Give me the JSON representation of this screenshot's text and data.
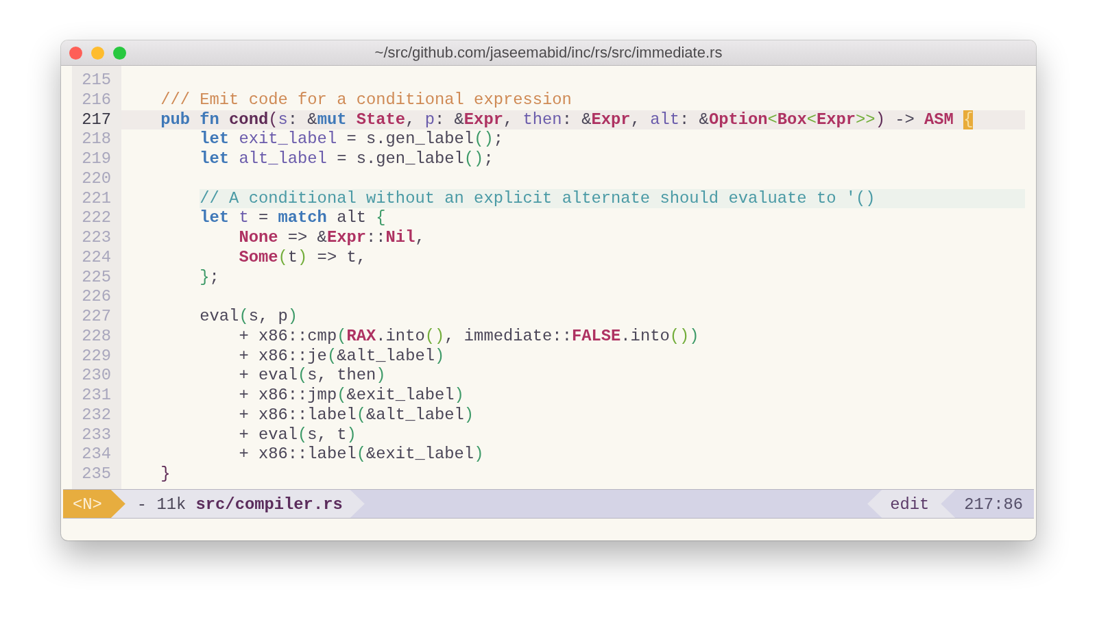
{
  "window": {
    "title": "~/src/github.com/jaseemabid/inc/rs/src/immediate.rs"
  },
  "editor": {
    "lines": [
      {
        "number": "215",
        "current": false
      },
      {
        "number": "216",
        "current": false,
        "tokens": [
          {
            "kind": "doc_comment",
            "text": "    /// Emit code for a conditional expression"
          }
        ]
      },
      {
        "number": "217",
        "current": true,
        "tokens": [
          {
            "kind": "keyword",
            "text": "    pub "
          },
          {
            "kind": "keyword",
            "text": "fn "
          },
          {
            "kind": "function",
            "text": "cond"
          },
          {
            "kind": "bracket_1",
            "text": "("
          },
          {
            "kind": "param",
            "text": "s"
          },
          {
            "kind": "plain",
            "text": ": &"
          },
          {
            "kind": "keyword",
            "text": "mut "
          },
          {
            "kind": "type",
            "text": "State"
          },
          {
            "kind": "plain",
            "text": ", "
          },
          {
            "kind": "param",
            "text": "p"
          },
          {
            "kind": "plain",
            "text": ": &"
          },
          {
            "kind": "type",
            "text": "Expr"
          },
          {
            "kind": "plain",
            "text": ", "
          },
          {
            "kind": "param",
            "text": "then"
          },
          {
            "kind": "plain",
            "text": ": &"
          },
          {
            "kind": "type",
            "text": "Expr"
          },
          {
            "kind": "plain",
            "text": ", "
          },
          {
            "kind": "param",
            "text": "alt"
          },
          {
            "kind": "plain",
            "text": ": &"
          },
          {
            "kind": "type",
            "text": "Option"
          },
          {
            "kind": "bracket_3",
            "text": "<"
          },
          {
            "kind": "type",
            "text": "Box"
          },
          {
            "kind": "bracket_3",
            "text": "<"
          },
          {
            "kind": "type",
            "text": "Expr"
          },
          {
            "kind": "bracket_3",
            "text": ">>"
          },
          {
            "kind": "bracket_1",
            "text": ")"
          },
          {
            "kind": "plain",
            "text": " -> "
          },
          {
            "kind": "type",
            "text": "ASM "
          },
          {
            "kind": "cursor",
            "text": "{"
          }
        ]
      },
      {
        "number": "218",
        "current": false,
        "tokens": [
          {
            "kind": "keyword",
            "text": "        let "
          },
          {
            "kind": "param",
            "text": "exit_label"
          },
          {
            "kind": "plain",
            "text": " = s.gen_label"
          },
          {
            "kind": "bracket_2",
            "text": "()"
          },
          {
            "kind": "plain",
            "text": ";"
          }
        ]
      },
      {
        "number": "219",
        "current": false,
        "tokens": [
          {
            "kind": "keyword",
            "text": "        let "
          },
          {
            "kind": "param",
            "text": "alt_label"
          },
          {
            "kind": "plain",
            "text": " = s.gen_label"
          },
          {
            "kind": "bracket_2",
            "text": "()"
          },
          {
            "kind": "plain",
            "text": ";"
          }
        ]
      },
      {
        "number": "220",
        "current": false
      },
      {
        "number": "221",
        "current": false,
        "tokens": [
          {
            "kind": "comment",
            "text": "        // A conditional without an explicit alternate should evaluate to '()"
          }
        ]
      },
      {
        "number": "222",
        "current": false,
        "tokens": [
          {
            "kind": "keyword",
            "text": "        let "
          },
          {
            "kind": "param",
            "text": "t"
          },
          {
            "kind": "plain",
            "text": " = "
          },
          {
            "kind": "keyword",
            "text": "match"
          },
          {
            "kind": "plain",
            "text": " alt "
          },
          {
            "kind": "bracket_2",
            "text": "{"
          }
        ]
      },
      {
        "number": "223",
        "current": false,
        "tokens": [
          {
            "kind": "type",
            "text": "            None"
          },
          {
            "kind": "plain",
            "text": " => &"
          },
          {
            "kind": "type",
            "text": "Expr"
          },
          {
            "kind": "plain",
            "text": "::"
          },
          {
            "kind": "type",
            "text": "Nil"
          },
          {
            "kind": "plain",
            "text": ","
          }
        ]
      },
      {
        "number": "224",
        "current": false,
        "tokens": [
          {
            "kind": "type",
            "text": "            Some"
          },
          {
            "kind": "bracket_3",
            "text": "("
          },
          {
            "kind": "plain",
            "text": "t"
          },
          {
            "kind": "bracket_3",
            "text": ")"
          },
          {
            "kind": "plain",
            "text": " => t,"
          }
        ]
      },
      {
        "number": "225",
        "current": false,
        "tokens": [
          {
            "kind": "bracket_2",
            "text": "        }"
          },
          {
            "kind": "plain",
            "text": ";"
          }
        ]
      },
      {
        "number": "226",
        "current": false
      },
      {
        "number": "227",
        "current": false,
        "tokens": [
          {
            "kind": "plain",
            "text": "        eval"
          },
          {
            "kind": "bracket_2",
            "text": "("
          },
          {
            "kind": "plain",
            "text": "s, p"
          },
          {
            "kind": "bracket_2",
            "text": ")"
          }
        ]
      },
      {
        "number": "228",
        "current": false,
        "tokens": [
          {
            "kind": "plain",
            "text": "            + x86::cmp"
          },
          {
            "kind": "bracket_2",
            "text": "("
          },
          {
            "kind": "type",
            "text": "RAX"
          },
          {
            "kind": "plain",
            "text": ".into"
          },
          {
            "kind": "bracket_3",
            "text": "()"
          },
          {
            "kind": "plain",
            "text": ", immediate::"
          },
          {
            "kind": "type",
            "text": "FALSE"
          },
          {
            "kind": "plain",
            "text": ".into"
          },
          {
            "kind": "bracket_3",
            "text": "()"
          },
          {
            "kind": "bracket_2",
            "text": ")"
          }
        ]
      },
      {
        "number": "229",
        "current": false,
        "tokens": [
          {
            "kind": "plain",
            "text": "            + x86::je"
          },
          {
            "kind": "bracket_2",
            "text": "("
          },
          {
            "kind": "plain",
            "text": "&alt_label"
          },
          {
            "kind": "bracket_2",
            "text": ")"
          }
        ]
      },
      {
        "number": "230",
        "current": false,
        "tokens": [
          {
            "kind": "plain",
            "text": "            + eval"
          },
          {
            "kind": "bracket_2",
            "text": "("
          },
          {
            "kind": "plain",
            "text": "s, then"
          },
          {
            "kind": "bracket_2",
            "text": ")"
          }
        ]
      },
      {
        "number": "231",
        "current": false,
        "tokens": [
          {
            "kind": "plain",
            "text": "            + x86::jmp"
          },
          {
            "kind": "bracket_2",
            "text": "("
          },
          {
            "kind": "plain",
            "text": "&exit_label"
          },
          {
            "kind": "bracket_2",
            "text": ")"
          }
        ]
      },
      {
        "number": "232",
        "current": false,
        "tokens": [
          {
            "kind": "plain",
            "text": "            + x86::label"
          },
          {
            "kind": "bracket_2",
            "text": "("
          },
          {
            "kind": "plain",
            "text": "&alt_label"
          },
          {
            "kind": "bracket_2",
            "text": ")"
          }
        ]
      },
      {
        "number": "233",
        "current": false,
        "tokens": [
          {
            "kind": "plain",
            "text": "            + eval"
          },
          {
            "kind": "bracket_2",
            "text": "("
          },
          {
            "kind": "plain",
            "text": "s, t"
          },
          {
            "kind": "bracket_2",
            "text": ")"
          }
        ]
      },
      {
        "number": "234",
        "current": false,
        "tokens": [
          {
            "kind": "plain",
            "text": "            + x86::label"
          },
          {
            "kind": "bracket_2",
            "text": "("
          },
          {
            "kind": "plain",
            "text": "&exit_label"
          },
          {
            "kind": "bracket_2",
            "text": ")"
          }
        ]
      },
      {
        "number": "235",
        "current": false,
        "tokens": [
          {
            "kind": "bracket_1",
            "text": "    }"
          }
        ]
      }
    ]
  },
  "status_bar": {
    "mode": "<N>",
    "file_info": "- 11k **src/compiler.rs**",
    "edit_state": "edit",
    "position": "217:86"
  }
}
